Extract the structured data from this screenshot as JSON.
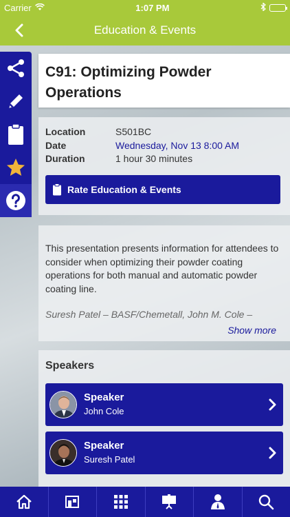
{
  "status_bar": {
    "carrier": "Carrier",
    "time": "1:07 PM"
  },
  "nav": {
    "title": "Education & Events"
  },
  "sidebar": {
    "items": [
      {
        "icon": "share-icon"
      },
      {
        "icon": "pencil-icon"
      },
      {
        "icon": "clipboard-icon"
      },
      {
        "icon": "star-icon"
      },
      {
        "icon": "help-icon"
      }
    ]
  },
  "session": {
    "title": "C91: Optimizing Powder Operations",
    "location_label": "Location",
    "location_value": "S501BC",
    "date_label": "Date",
    "date_value": "Wednesday, Nov 13 8:00 AM",
    "duration_label": "Duration",
    "duration_value": "1 hour 30 minutes",
    "rate_button": "Rate Education & Events"
  },
  "description": {
    "text": "This presentation presents information for attendees to consider when optimizing their powder coating operations for both manual and automatic powder coating line.",
    "truncated": "Suresh Patel – BASF/Chemetall, John M. Cole –",
    "show_more": "Show more"
  },
  "speakers": {
    "heading": "Speakers",
    "list": [
      {
        "role": "Speaker",
        "name": "John Cole"
      },
      {
        "role": "Speaker",
        "name": "Suresh Patel"
      }
    ]
  },
  "tabbar": {
    "items": [
      {
        "icon": "home-icon"
      },
      {
        "icon": "exhibitor-icon"
      },
      {
        "icon": "grid-icon"
      },
      {
        "icon": "presentation-icon"
      },
      {
        "icon": "speaker-icon"
      },
      {
        "icon": "search-icon"
      }
    ]
  },
  "colors": {
    "accent": "#a8c93a",
    "primary": "#1a1a9c",
    "star": "#f2b53a"
  }
}
